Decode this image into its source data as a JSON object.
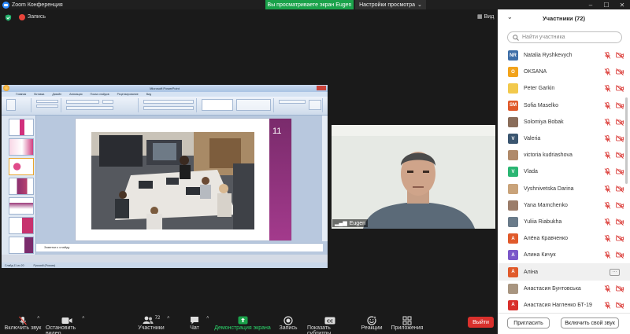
{
  "titlebar": {
    "app_title": "Zoom Конференция",
    "share_banner": "Вы просматриваете экран Eugen",
    "view_settings": "Настройки просмотра",
    "colors": {
      "share_banner": "#1aa24a",
      "bar": "#1f1f1f"
    }
  },
  "meeting": {
    "recording_label": "Запись",
    "view_label": "Вид",
    "camera_name": "Eugen"
  },
  "shared_screen": {
    "window_title": "Microsoft PowerPoint",
    "tabs": [
      "Главная",
      "Вставка",
      "Дизайн",
      "Анимация",
      "Показ слайдов",
      "Рецензирование",
      "Вид"
    ],
    "slide_number": "11",
    "notes_placeholder": "Заметки к слайду",
    "status_items": [
      "Слайд 11 из 20",
      "Русский (Россия)"
    ]
  },
  "toolbar": {
    "items": [
      {
        "label": "Включить звук",
        "icon": "mic-muted-icon"
      },
      {
        "label": "Остановить видео",
        "icon": "video-camera-icon"
      },
      {
        "label": "Участники",
        "icon": "participants-icon",
        "count": "72"
      },
      {
        "label": "Чат",
        "icon": "chat-icon"
      },
      {
        "label": "Демонстрация экрана",
        "icon": "share-screen-icon"
      },
      {
        "label": "Запись",
        "icon": "record-icon"
      },
      {
        "label": "Показать субтитры",
        "icon": "cc-icon"
      },
      {
        "label": "Реакции",
        "icon": "reactions-icon"
      },
      {
        "label": "Приложения",
        "icon": "apps-icon"
      }
    ],
    "leave_label": "Выйти",
    "colors": {
      "leave": "#d9302c",
      "share_active": "#1aa24a"
    }
  },
  "participants": {
    "title": "Участники (72)",
    "search_placeholder": "Найти участника",
    "list": [
      {
        "name": "Natalia Ryshkevych",
        "initials": "NR",
        "color": "#3f6fa8"
      },
      {
        "name": "OKSANA",
        "initials": "O",
        "color": "#f2a31b"
      },
      {
        "name": "Peter Garkin",
        "initials": "",
        "color": "#f2c94c"
      },
      {
        "name": "Sofia Maselko",
        "initials": "SM",
        "color": "#e05a2b"
      },
      {
        "name": "Solomiya Bobak",
        "initials": "",
        "color": "#8a6d5a"
      },
      {
        "name": "Valeria",
        "initials": "V",
        "color": "#3b5670"
      },
      {
        "name": "victoria kudriashova",
        "initials": "",
        "color": "#b08a6a"
      },
      {
        "name": "Vlada",
        "initials": "V",
        "color": "#2bb673"
      },
      {
        "name": "Vyshnivetska Darina",
        "initials": "",
        "color": "#c9a37a"
      },
      {
        "name": "Yana Mamchenko",
        "initials": "",
        "color": "#9b7d6a"
      },
      {
        "name": "Yuliia Riabukha",
        "initials": "",
        "color": "#6a7b8a"
      },
      {
        "name": "Алёна Кравченко",
        "initials": "А",
        "color": "#e05a2b"
      },
      {
        "name": "Алина Кичук",
        "initials": "А",
        "color": "#7b57c9"
      },
      {
        "name": "Аліна",
        "initials": "А",
        "color": "#e05a2b"
      },
      {
        "name": "Анастасия Бунтовська",
        "initials": "",
        "color": "#a89580"
      },
      {
        "name": "Анастасия Наrленко БТ-19",
        "initials": "А",
        "color": "#d9302c"
      }
    ],
    "highlighted_index": 13,
    "invite_label": "Пригласить",
    "unmute_me_label": "Включить свой звук"
  }
}
